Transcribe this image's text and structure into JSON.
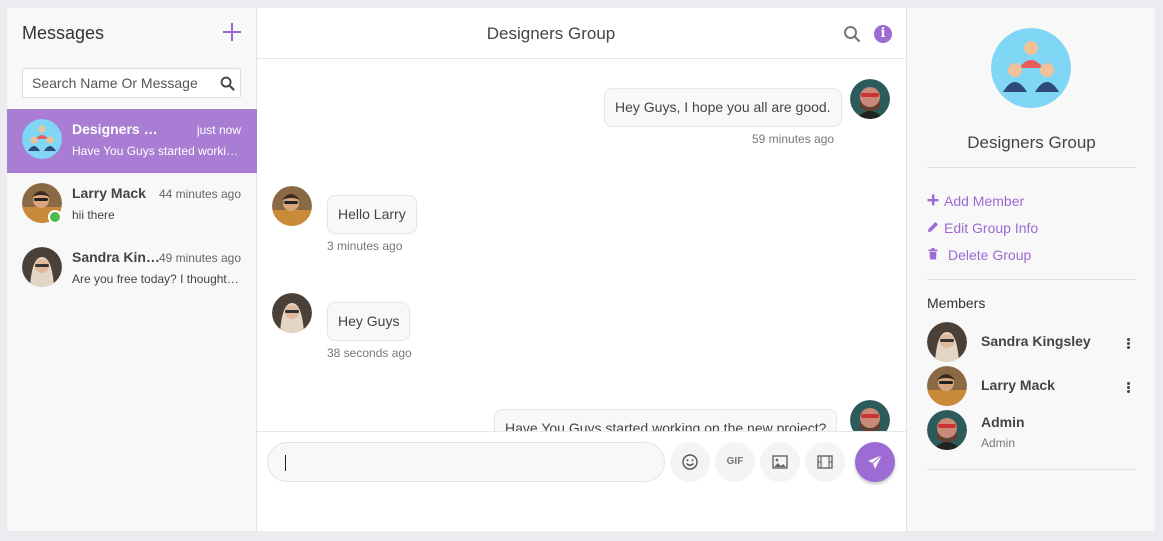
{
  "sidebar": {
    "title": "Messages",
    "search_placeholder": "Search Name Or Message",
    "conversations": [
      {
        "name": "Designers Group",
        "time": "just now",
        "preview": "Have You Guys started working on the new project?",
        "active": true
      },
      {
        "name": "Larry Mack",
        "time": "44 minutes ago",
        "preview": "hii there",
        "online": true
      },
      {
        "name": "Sandra Kingsley",
        "time": "49 minutes ago",
        "preview": "Are you free today? I thought we could meet up"
      }
    ]
  },
  "chat": {
    "title": "Designers Group",
    "messages": [
      {
        "side": "right",
        "text": "Hey Guys, I hope you all are good.",
        "time": "59 minutes ago"
      },
      {
        "side": "left",
        "text": "Hello Larry",
        "time": "3 minutes ago"
      },
      {
        "side": "left",
        "text": "Hey Guys",
        "time": "38 seconds ago"
      },
      {
        "side": "right",
        "text": "Have You Guys started working on the new project?"
      }
    ],
    "composer": {
      "value": "",
      "tools": [
        "smiley-icon",
        "gif-icon",
        "image-icon",
        "video-icon"
      ],
      "gif_label": "GIF"
    }
  },
  "info_panel": {
    "group_name": "Designers Group",
    "actions": [
      {
        "icon": "plus-icon",
        "label": "Add Member"
      },
      {
        "icon": "pencil-icon",
        "label": "Edit Group Info"
      },
      {
        "icon": "trash-icon",
        "label": "Delete Group"
      }
    ],
    "members_title": "Members",
    "members": [
      {
        "name": "Sandra Kingsley",
        "role": ""
      },
      {
        "name": "Larry Mack",
        "role": ""
      },
      {
        "name": "Admin",
        "role": "Admin"
      }
    ]
  },
  "colors": {
    "accent": "#9c6bd3",
    "active_conversation": "#a87dd3",
    "online": "#4cba4c",
    "background": "#ecebf0"
  }
}
